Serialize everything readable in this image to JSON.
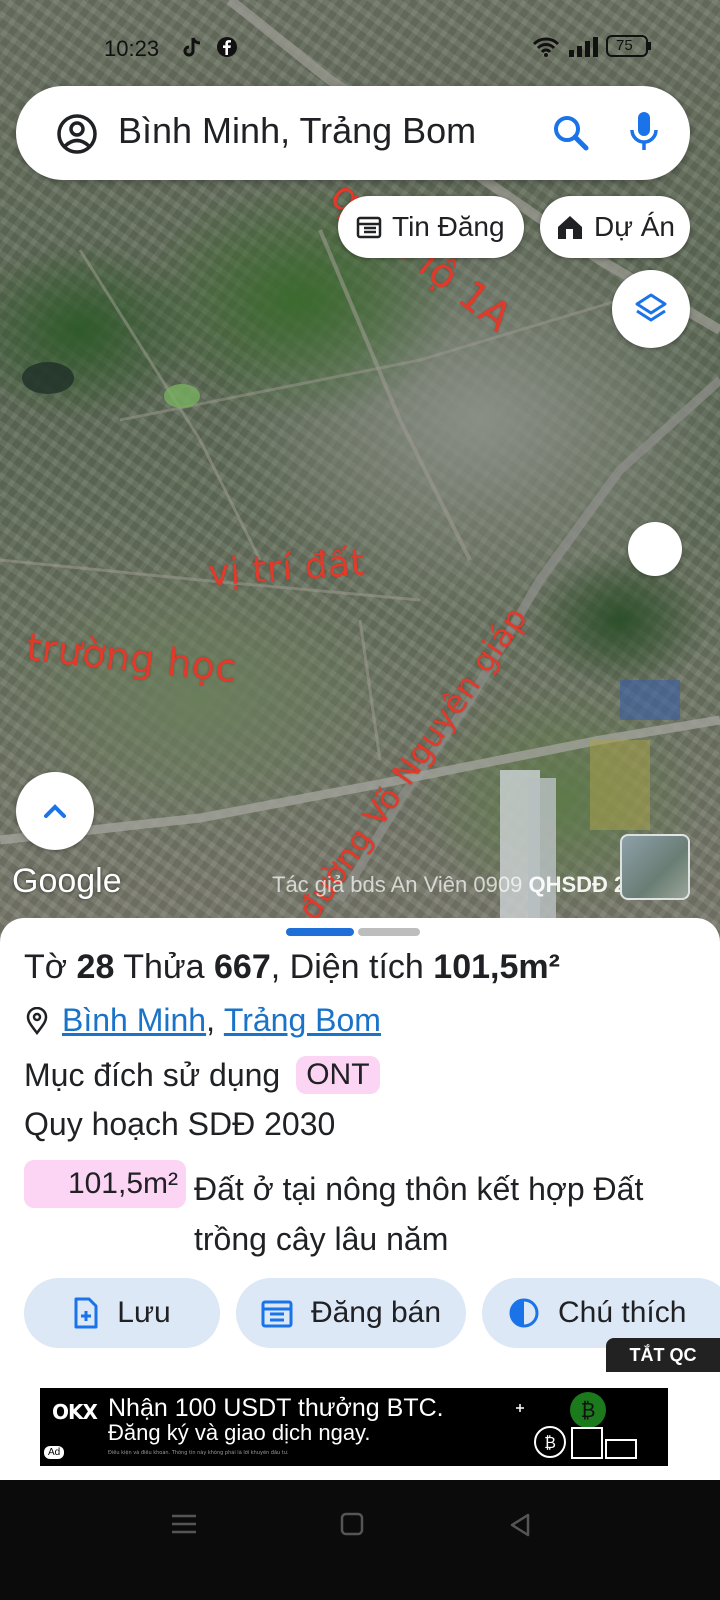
{
  "status_bar": {
    "time": "10:23",
    "battery": "75"
  },
  "search": {
    "text": "Bình Minh, Trảng Bom"
  },
  "chips": {
    "listings": "Tin Đăng",
    "projects": "Dự Án"
  },
  "map_labels": {
    "highway": "quốc lộ 1A",
    "land_location": "vị trí đất",
    "school": "trường học",
    "street": "đường Võ Nguyên giáp"
  },
  "map_footer": {
    "google": "Google",
    "watermark": "Tác giả bds An Viên 0909",
    "plan_label": "QHSDĐ 2030"
  },
  "parcel": {
    "sheet_label": "Tờ",
    "sheet_no": "28",
    "plot_label": "Thửa",
    "plot_no": "667",
    "area_label": "Diện tích",
    "area": "101,5m²",
    "ward": "Bình Minh",
    "district": "Trảng Bom",
    "purpose_label": "Mục đích sử dụng",
    "purpose_code": "ONT",
    "plan_title": "Quy hoạch SDĐ 2030",
    "plan_area": "101,5m²",
    "plan_desc": "Đất ở tại nông thôn kết hợp Đất trồng cây lâu năm"
  },
  "actions": {
    "save": "Lưu",
    "post_sale": "Đăng bán",
    "legend": "Chú thích"
  },
  "ad": {
    "close": "TẮT QC",
    "brand": "OKX",
    "line1": "Nhận 100 USDT thưởng BTC.",
    "line2": "Đăng ký và giao dịch ngay.",
    "fine": "Điều kiện và điều khoản. Thông tin này không phải là lời khuyên đầu tư.",
    "ad_tag": "Ad"
  },
  "colors": {
    "accent": "#1a73e8",
    "label_red": "#e23a2a",
    "badge_pink": "#fbd5f3",
    "button_bg": "#dce8f5"
  }
}
